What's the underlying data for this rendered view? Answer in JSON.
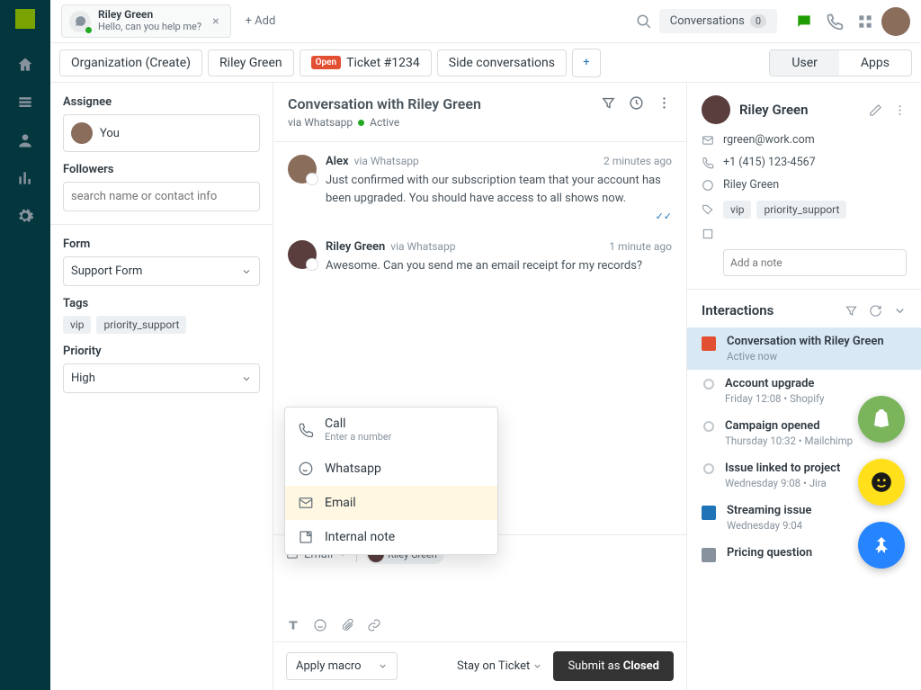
{
  "topbar": {
    "tab": {
      "name": "Riley Green",
      "sub": "Hello, can you help me?"
    },
    "add": "+ Add",
    "conversations": "Conversations",
    "conv_count": "0"
  },
  "tabs": {
    "org": "Organization (Create)",
    "person": "Riley Green",
    "open_pill": "Open",
    "ticket": "Ticket #1234",
    "side": "Side conversations",
    "user": "User",
    "apps": "Apps"
  },
  "left": {
    "assignee_label": "Assignee",
    "assignee_value": "You",
    "followers_label": "Followers",
    "followers_placeholder": "search name or contact info",
    "form_label": "Form",
    "form_value": "Support Form",
    "tags_label": "Tags",
    "tag1": "vip",
    "tag2": "priority_support",
    "priority_label": "Priority",
    "priority_value": "High"
  },
  "conv": {
    "title": "Conversation with Riley Green",
    "via": "via Whatsapp",
    "status": "Active",
    "m1_name": "Alex",
    "m1_via": "via Whatsapp",
    "m1_time": "2 minutes ago",
    "m1_text": "Just confirmed with our subscription team that your account has been upgraded. You should have access to all shows now.",
    "m2_name": "Riley Green",
    "m2_via": "via Whatsapp",
    "m2_time": "1 minute ago",
    "m2_text": "Awesome. Can you send me an email receipt for my records?"
  },
  "popup": {
    "call": "Call",
    "call_sub": "Enter a number",
    "whatsapp": "Whatsapp",
    "email": "Email",
    "note": "Internal note"
  },
  "composer": {
    "channel": "Email",
    "recipient": "Riley Green"
  },
  "footer": {
    "macro": "Apply macro",
    "stay": "Stay on Ticket",
    "submit_prefix": "Submit as ",
    "submit_status": "Closed"
  },
  "right": {
    "name": "Riley Green",
    "email": "rgreen@work.com",
    "phone": "+1 (415) 123-4567",
    "wa": "Riley Green",
    "tag1": "vip",
    "tag2": "priority_support",
    "note_ph": "Add a note",
    "inter_title": "Interactions",
    "i1_name": "Conversation with Riley Green",
    "i1_sub": "Active now",
    "i2_name": "Account upgrade",
    "i2_sub": "Friday 12:08 • Shopify",
    "i3_name": "Campaign opened",
    "i3_sub": "Thursday 10:32 • Mailchimp",
    "i4_name": "Issue linked to project",
    "i4_sub": "Wednesday 9:08 • Jira",
    "i5_name": "Streaming issue",
    "i5_sub": "Wednesday 9:04",
    "i6_name": "Pricing question"
  }
}
